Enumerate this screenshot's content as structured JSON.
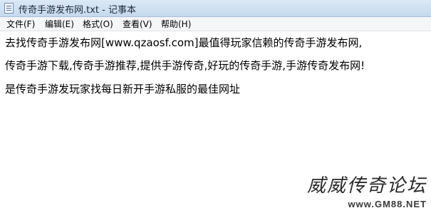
{
  "window": {
    "title": "传奇手游发布网.txt - 记事本",
    "icon": "notepad-icon"
  },
  "menu": {
    "items": [
      {
        "label": "文件(F)"
      },
      {
        "label": "编辑(E)"
      },
      {
        "label": "格式(O)"
      },
      {
        "label": "查看(V)"
      },
      {
        "label": "帮助(H)"
      }
    ]
  },
  "editor": {
    "lines": [
      "去找传奇手游发布网[www.qzaosf.com]最值得玩家信赖的传奇手游发布网,",
      "传奇手游下载,传奇手游推荐,提供手游传奇,好玩的传奇手游,手游传奇发布网!",
      "是传奇手游发玩家找每日新开手游私服的最佳网址"
    ]
  },
  "watermark": {
    "title": "威威传奇论坛",
    "url": "www.GM88.NET"
  }
}
